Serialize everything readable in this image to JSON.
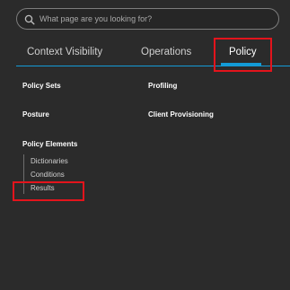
{
  "search": {
    "placeholder": "What page are you looking for?",
    "icon": "search-icon"
  },
  "tabs": [
    {
      "label": "Context Visibility"
    },
    {
      "label": "Operations"
    },
    {
      "label": "Policy",
      "active": true
    }
  ],
  "menu": {
    "col1": {
      "policy_sets": "Policy Sets",
      "posture": "Posture",
      "policy_elements": "Policy Elements",
      "sub_items": [
        "Dictionaries",
        "Conditions",
        "Results"
      ]
    },
    "col2": {
      "profiling": "Profiling",
      "client_provisioning": "Client Provisioning"
    }
  },
  "colors": {
    "background": "#2b2b2b",
    "accent": "#139bd7",
    "highlight": "#e3141c"
  }
}
